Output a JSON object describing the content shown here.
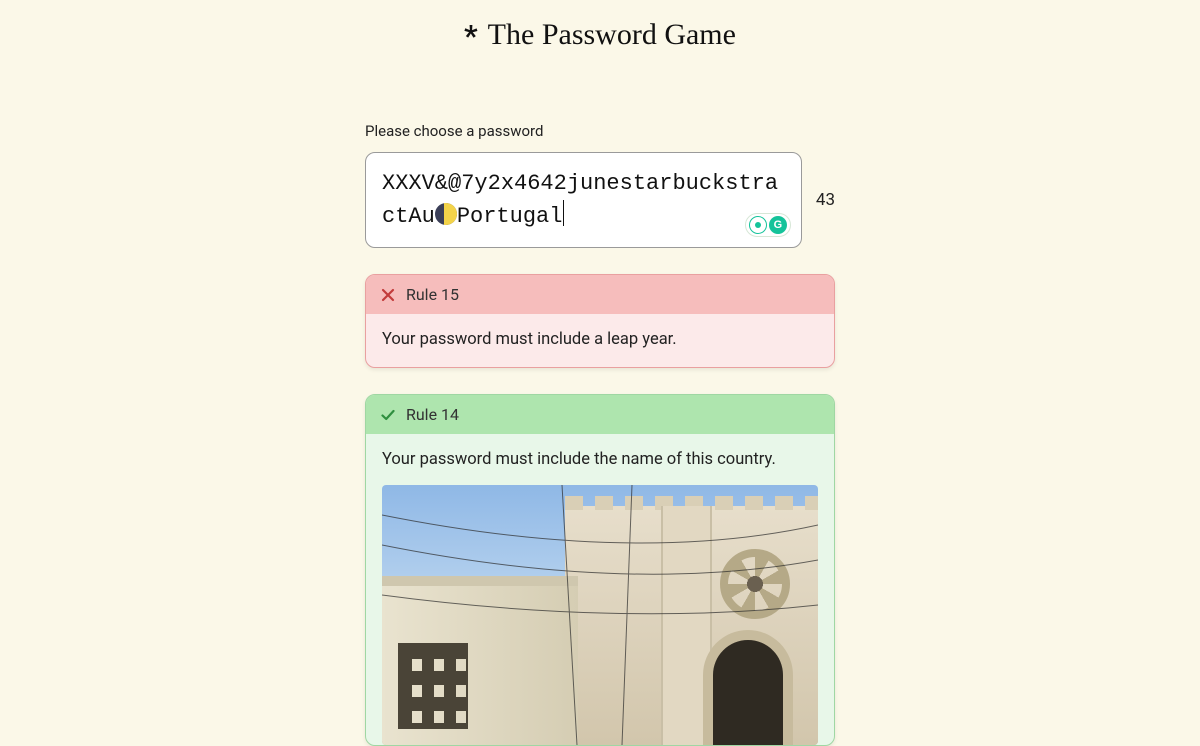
{
  "header": {
    "asterisk": "*",
    "title": "The Password Game"
  },
  "prompt": "Please choose a password",
  "password": {
    "part1": "XXXV&@7y2x4642junestarbuckstractAu",
    "part2": "Portugal",
    "char_count": "43"
  },
  "rules": [
    {
      "status": "fail",
      "label": "Rule 15",
      "text": "Your password must include a leap year."
    },
    {
      "status": "pass",
      "label": "Rule 14",
      "text": "Your password must include the name of this country."
    }
  ],
  "grammarly": {
    "letter": "G"
  }
}
